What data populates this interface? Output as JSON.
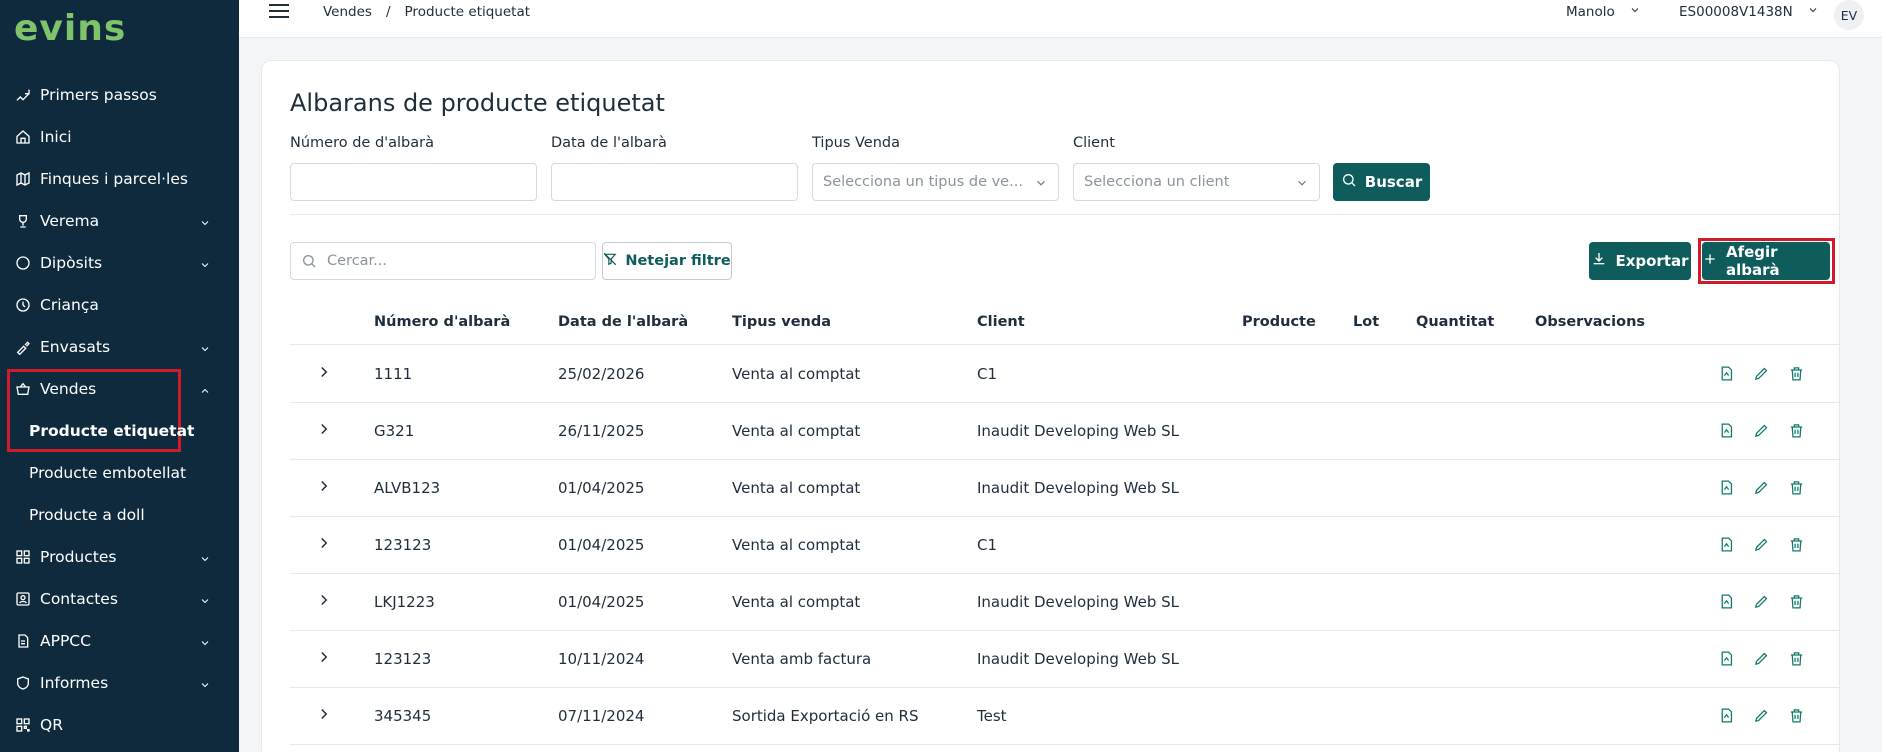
{
  "sidebar": {
    "logo": "evins",
    "items": [
      {
        "label": "Primers passos"
      },
      {
        "label": "Inici"
      },
      {
        "label": "Finques i parcel·les"
      },
      {
        "label": "Verema"
      },
      {
        "label": "Dipòsits"
      },
      {
        "label": "Criança"
      },
      {
        "label": "Envasats"
      },
      {
        "label": "Vendes"
      },
      {
        "label": "Productes"
      },
      {
        "label": "Contactes"
      },
      {
        "label": "APPCC"
      },
      {
        "label": "Informes"
      },
      {
        "label": "QR"
      }
    ],
    "subitems": [
      {
        "label": "Producte etiquetat"
      },
      {
        "label": "Producte embotellat"
      },
      {
        "label": "Producte a doll"
      }
    ]
  },
  "topbar": {
    "breadcrumb": [
      "Vendes",
      "/",
      "Producte etiquetat"
    ],
    "user": "Manolo",
    "company": "ES00008V1438N",
    "avatar": "EV"
  },
  "page": {
    "title": "Albarans de producte etiquetat",
    "filters": {
      "num_label": "Número de d'albarà",
      "date_label": "Data de l'albarà",
      "type_label": "Tipus Venda",
      "type_placeholder": "Selecciona un tipus de ve...",
      "client_label": "Client",
      "client_placeholder": "Selecciona un client",
      "search_button": "Buscar"
    },
    "search_placeholder": "Cercar...",
    "clear_filter": "Netejar filtre",
    "export_button": "Exportar",
    "add_button": "Afegir albarà"
  },
  "table": {
    "columns": [
      "Número d'albarà",
      "Data de l'albarà",
      "Tipus venda",
      "Client",
      "Producte",
      "Lot",
      "Quantitat",
      "Observacions"
    ],
    "rows": [
      {
        "num": "1111",
        "date": "25/02/2026",
        "type": "Venta al comptat",
        "client": "C1"
      },
      {
        "num": "G321",
        "date": "26/11/2025",
        "type": "Venta al comptat",
        "client": "Inaudit Developing Web SL"
      },
      {
        "num": "ALVB123",
        "date": "01/04/2025",
        "type": "Venta al comptat",
        "client": "Inaudit Developing Web SL"
      },
      {
        "num": "123123",
        "date": "01/04/2025",
        "type": "Venta al comptat",
        "client": "C1"
      },
      {
        "num": "LKJ1223",
        "date": "01/04/2025",
        "type": "Venta al comptat",
        "client": "Inaudit Developing Web SL"
      },
      {
        "num": "123123",
        "date": "10/11/2024",
        "type": "Venta amb factura",
        "client": "Inaudit Developing Web SL"
      },
      {
        "num": "345345",
        "date": "07/11/2024",
        "type": "Sortida Exportació en RS",
        "client": "Test"
      }
    ]
  },
  "colors": {
    "sidebar_bg": "#0f2a3d",
    "accent": "#0f5c5c",
    "logo": "#7fc36b",
    "highlight": "#d11a2a"
  }
}
